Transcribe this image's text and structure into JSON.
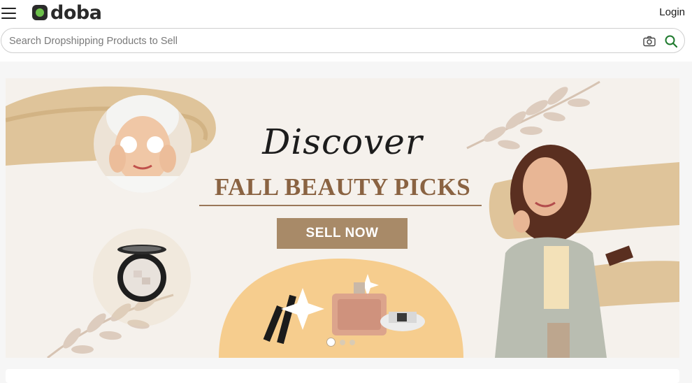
{
  "header": {
    "logo_text": "doba",
    "login_label": "Login",
    "menu_icon": "hamburger-menu-icon"
  },
  "search": {
    "placeholder": "Search Dropshipping Products to Sell",
    "value": "",
    "camera_icon": "camera-icon",
    "search_icon": "search-icon"
  },
  "banner": {
    "discover": "Discover",
    "headline": "FALL BEAUTY PICKS",
    "cta_label": "SELL NOW",
    "slide_count": 3,
    "active_slide": 1
  },
  "colors": {
    "brand_green": "#6cc04a",
    "cta_brown": "#a88a68",
    "headline_brown": "#8a6342",
    "banner_bg": "#f5f1ec"
  }
}
